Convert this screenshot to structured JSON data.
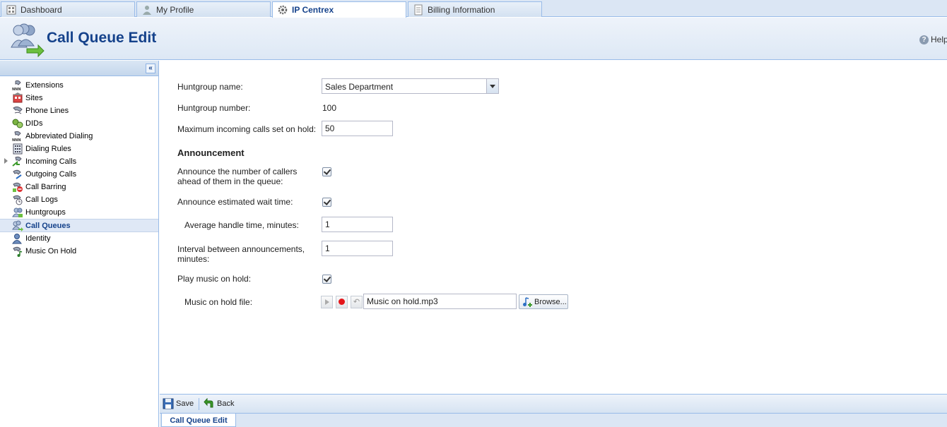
{
  "tabs": [
    {
      "label": "Dashboard",
      "icon": "dashboard-icon"
    },
    {
      "label": "My Profile",
      "icon": "user-icon"
    },
    {
      "label": "IP Centrex",
      "icon": "gear-icon"
    },
    {
      "label": "Billing Information",
      "icon": "document-icon"
    }
  ],
  "header": {
    "title": "Call Queue Edit",
    "help_label": "Help",
    "logo_icon": "call-queue-icon"
  },
  "sidebar": {
    "collapse_icon": "double-chevron-left-icon",
    "items": [
      {
        "label": "Extensions",
        "icon": "extensions-icon"
      },
      {
        "label": "Sites",
        "icon": "sites-icon"
      },
      {
        "label": "Phone Lines",
        "icon": "phone-lines-icon"
      },
      {
        "label": "DIDs",
        "icon": "dids-icon"
      },
      {
        "label": "Abbreviated Dialing",
        "icon": "abbreviated-dialing-icon"
      },
      {
        "label": "Dialing Rules",
        "icon": "dialing-rules-icon"
      },
      {
        "label": "Incoming Calls",
        "icon": "incoming-calls-icon"
      },
      {
        "label": "Outgoing Calls",
        "icon": "outgoing-calls-icon"
      },
      {
        "label": "Call Barring",
        "icon": "call-barring-icon"
      },
      {
        "label": "Call Logs",
        "icon": "call-logs-icon"
      },
      {
        "label": "Huntgroups",
        "icon": "huntgroups-icon"
      },
      {
        "label": "Call Queues",
        "icon": "call-queues-icon"
      },
      {
        "label": "Identity",
        "icon": "identity-icon"
      },
      {
        "label": "Music On Hold",
        "icon": "music-on-hold-icon"
      }
    ]
  },
  "form": {
    "huntgroup_name_label": "Huntgroup name:",
    "huntgroup_name_value": "Sales Department",
    "huntgroup_number_label": "Huntgroup number:",
    "huntgroup_number_value": "100",
    "max_calls_label": "Maximum incoming calls set on hold:",
    "max_calls_value": "50",
    "announcement_heading": "Announcement",
    "announce_callers_label_1": "Announce the number of callers",
    "announce_callers_label_2": "ahead of them in the queue:",
    "announce_wait_label": "Announce estimated wait time:",
    "avg_handle_label": "Average handle time, minutes:",
    "avg_handle_value": "1",
    "interval_label_1": "Interval between announcements,",
    "interval_label_2": "minutes:",
    "interval_value": "1",
    "play_moh_label": "Play music on hold:",
    "moh_file_label": "Music on hold file:",
    "moh_file_value": "Music on hold.mp3",
    "browse_label": "Browse..."
  },
  "toolbar": {
    "save_label": "Save",
    "back_label": "Back"
  },
  "bottom_tab": {
    "label": "Call Queue Edit"
  },
  "colors": {
    "accent": "#15428b",
    "border": "#99bbe8",
    "record": "#e4161b"
  }
}
